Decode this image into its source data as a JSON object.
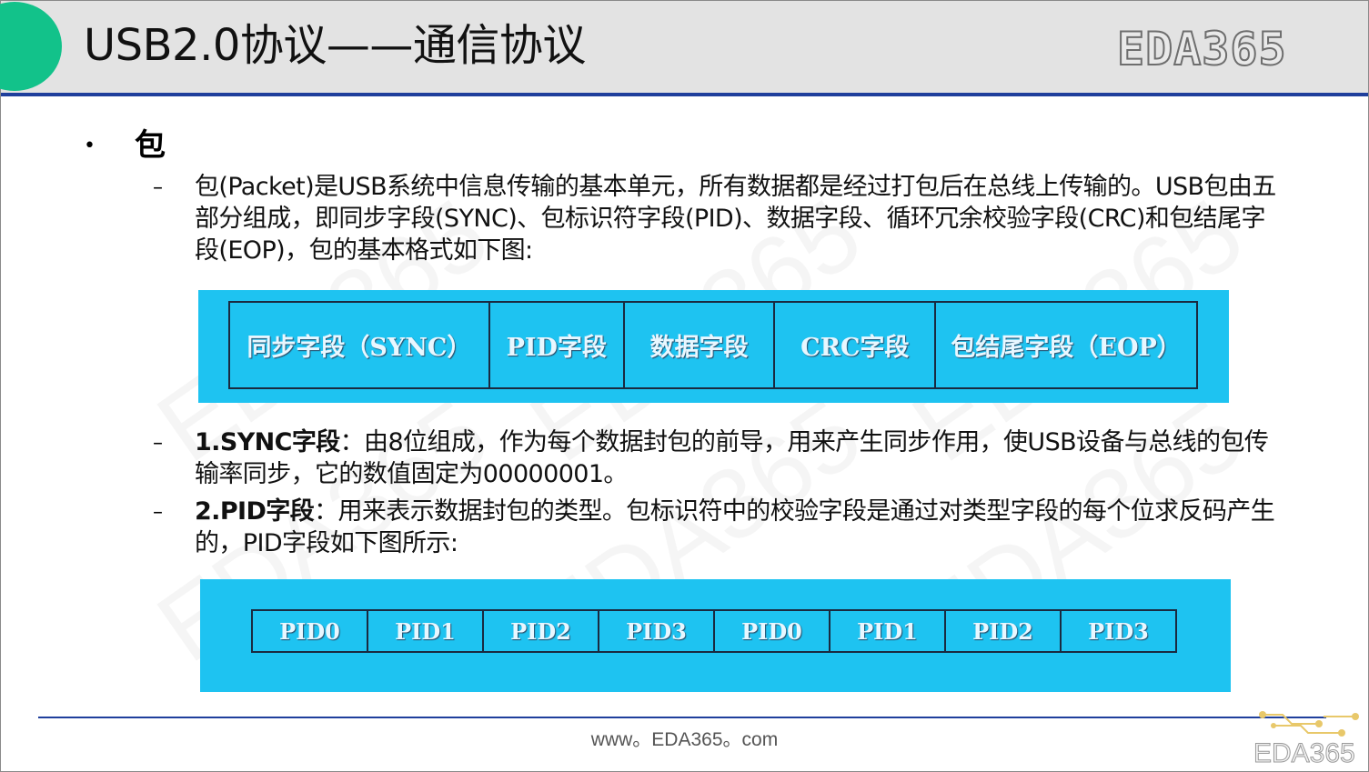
{
  "header": {
    "title": "USB2.0协议——通信协议",
    "logo": "EDA365"
  },
  "section": {
    "bullet": "•",
    "heading": "包",
    "dash": "–"
  },
  "paragraphs": {
    "p1": "包(Packet)是USB系统中信息传输的基本单元，所有数据都是经过打包后在总线上传输的。USB包由五部分组成，即同步字段(SYNC)、包标识符字段(PID)、数据字段、循环冗余校验字段(CRC)和包结尾字段(EOP)，包的基本格式如下图:",
    "p2_bold": "1.SYNC字段",
    "p2_text": "：由8位组成，作为每个数据封包的前导，用来产生同步作用，使USB设备与总线的包传输率同步，它的数值固定为00000001。",
    "p3_bold": "2.PID字段",
    "p3_text": "：用来表示数据封包的类型。包标识符中的校验字段是通过对类型字段的每个位求反码产生的，PID字段如下图所示:"
  },
  "packet_format": [
    "同步字段（SYNC）",
    "PID字段",
    "数据字段",
    "CRC字段",
    "包结尾字段（EOP）"
  ],
  "pid_fields": [
    "PID0",
    "PID1",
    "PID2",
    "PID3",
    "PID0",
    "PID1",
    "PID2",
    "PID3"
  ],
  "watermark": "EDA365",
  "footer": {
    "url": "www。EDA365。com",
    "corner_logo": "EDA365"
  },
  "colors": {
    "header_bg": "#e3e3e3",
    "header_line": "#1f3f9c",
    "accent_circle": "#12c28a",
    "figure_bg": "#1ec3f1"
  }
}
